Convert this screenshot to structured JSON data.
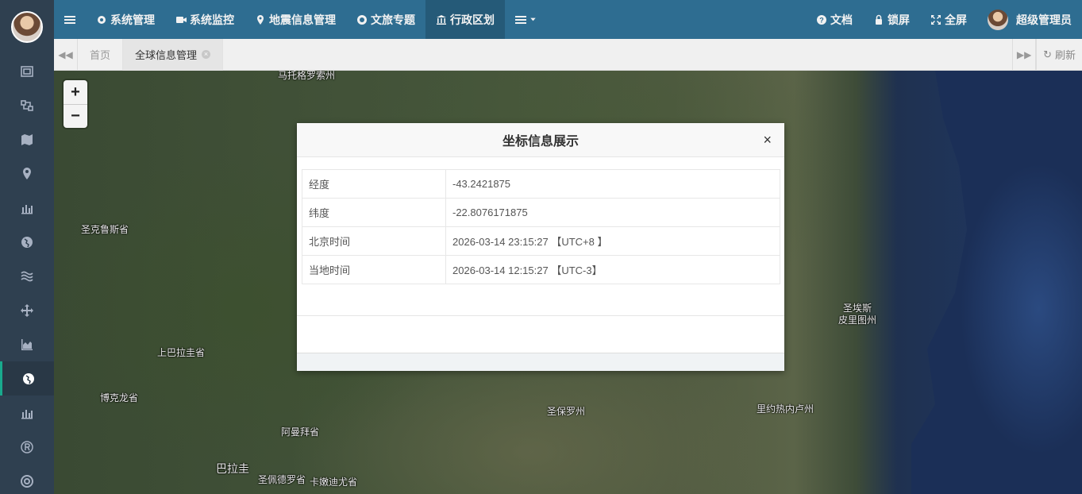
{
  "nav": {
    "items": [
      {
        "label": "系统管理",
        "icon": "gear-icon"
      },
      {
        "label": "系统监控",
        "icon": "video-icon"
      },
      {
        "label": "地震信息管理",
        "icon": "pin-icon"
      },
      {
        "label": "文旅专题",
        "icon": "lifebuoy-icon"
      },
      {
        "label": "行政区划",
        "icon": "bank-icon"
      }
    ],
    "docs": "文档",
    "lock": "锁屏",
    "fullscreen": "全屏",
    "user": "超级管理员"
  },
  "tabs": {
    "home": "首页",
    "current": "全球信息管理",
    "refresh": "刷新"
  },
  "map_labels": [
    "马托格罗索州",
    "圣克鲁斯省",
    "上巴拉圭省",
    "博克龙省",
    "阿曼拜省",
    "巴拉圭",
    "圣佩德罗省",
    "卡嫩迪尤省",
    "圣保罗州",
    "里约热内卢州",
    "圣埃斯",
    "皮里图州"
  ],
  "zoom": {
    "in": "+",
    "out": "−"
  },
  "modal": {
    "title": "坐标信息展示",
    "close": "×",
    "rows": [
      {
        "key": "经度",
        "value": "-43.2421875"
      },
      {
        "key": "纬度",
        "value": "-22.8076171875"
      },
      {
        "key": "北京时间",
        "value": "2026-03-14 23:15:27 【UTC+8 】"
      },
      {
        "key": "当地时间",
        "value": "2026-03-14 12:15:27 【UTC-3】"
      }
    ]
  }
}
